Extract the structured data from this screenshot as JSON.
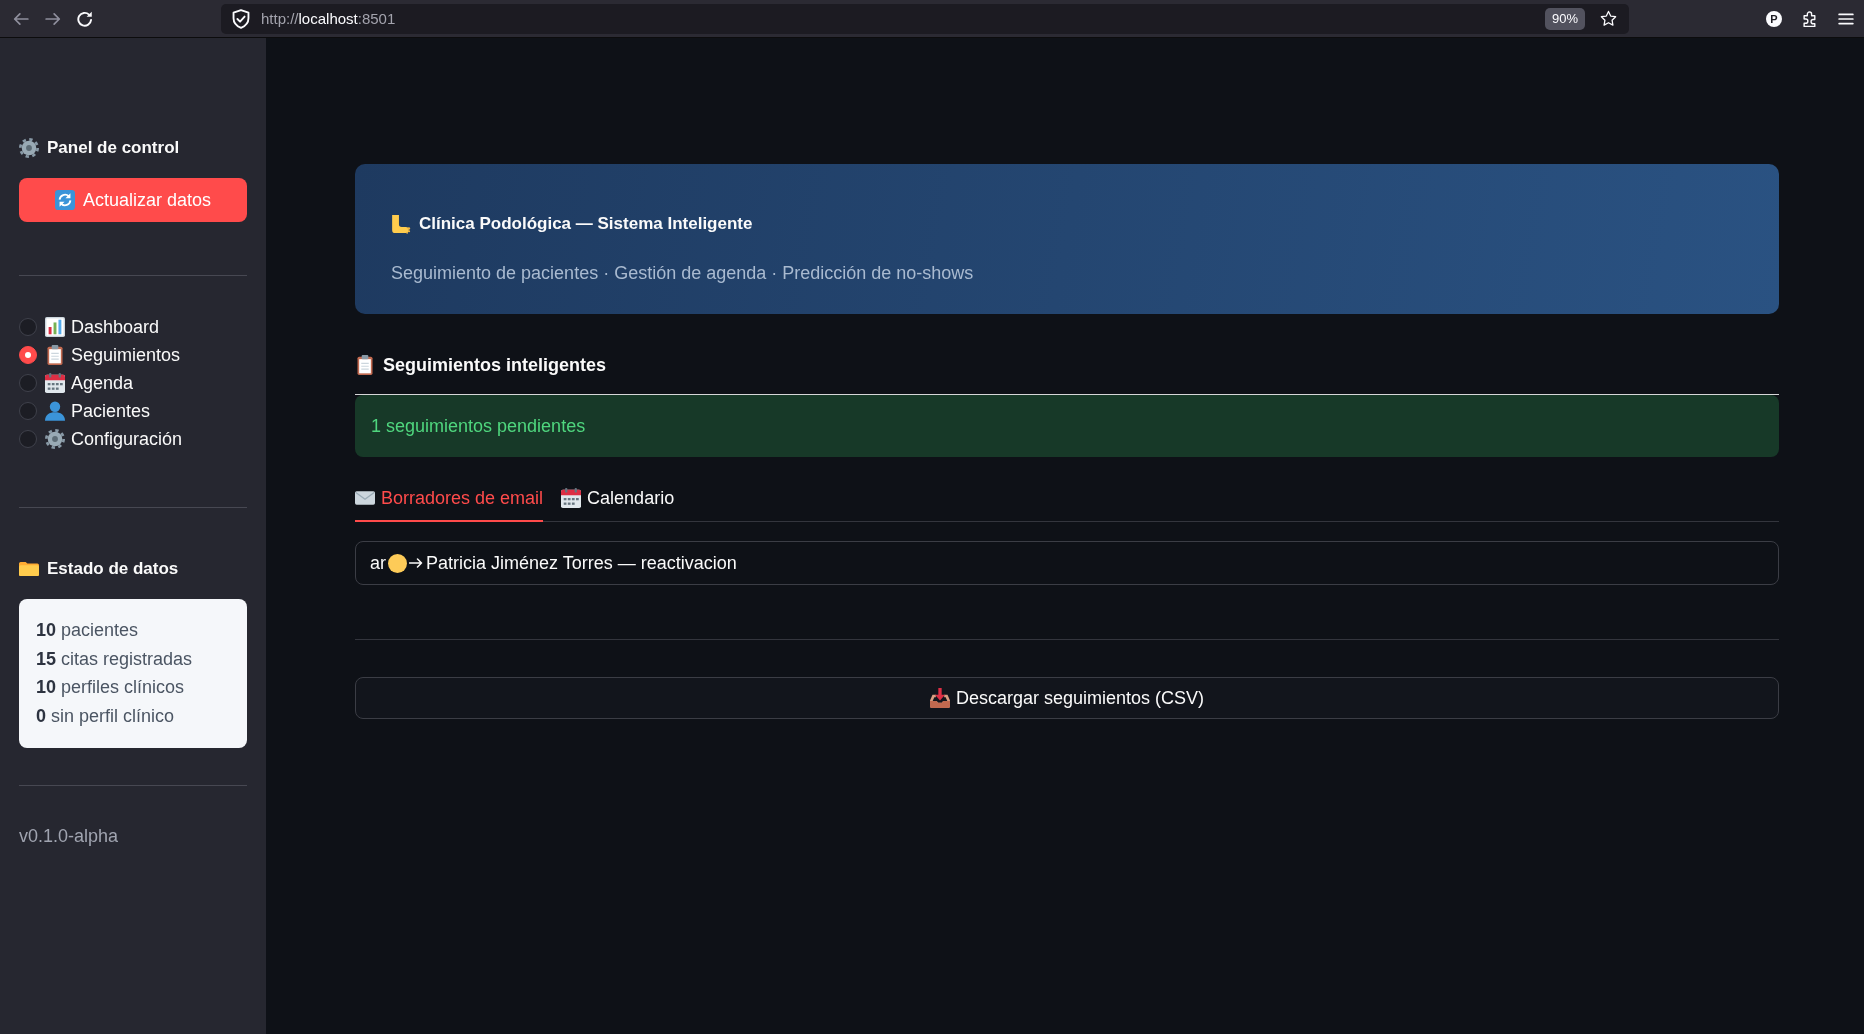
{
  "browser": {
    "url": [
      {
        "text": "http://",
        "kind": "dim"
      },
      {
        "text": "localhost",
        "kind": "host"
      },
      {
        "text": ":8501",
        "kind": "dim"
      }
    ],
    "zoom": "90%",
    "account_initial": "P"
  },
  "sidebar": {
    "title": "Panel de control",
    "refresh_button": "Actualizar datos",
    "nav": [
      {
        "label": "Dashboard",
        "selected": false
      },
      {
        "label": "Seguimientos",
        "selected": true
      },
      {
        "label": "Agenda",
        "selected": false
      },
      {
        "label": "Pacientes",
        "selected": false
      },
      {
        "label": "Configuración",
        "selected": false
      }
    ],
    "status_title": "Estado de datos",
    "stats": [
      "**10** pacientes",
      "**15** citas registradas",
      "**10** perfiles clínicos",
      "**0** sin perfil clínico"
    ],
    "version": "v0.1.0-alpha"
  },
  "header": {
    "title": "Clínica Podológica — Sistema Inteligente",
    "subtitle": "Seguimiento de pacientes · Gestión de agenda · Predicción de no-shows"
  },
  "section": {
    "title": "Seguimientos inteligentes",
    "alert": {
      "kind": "success",
      "text": "1 seguimientos pendientes"
    },
    "tabs": [
      {
        "label": "Borradores de email",
        "selected": true
      },
      {
        "label": "Calendario",
        "selected": false
      }
    ],
    "expander": {
      "clipped_text": "ar",
      "title": "Patricia Jiménez Torres — reactivacion"
    },
    "download_button": "Descargar seguimientos (CSV)"
  }
}
